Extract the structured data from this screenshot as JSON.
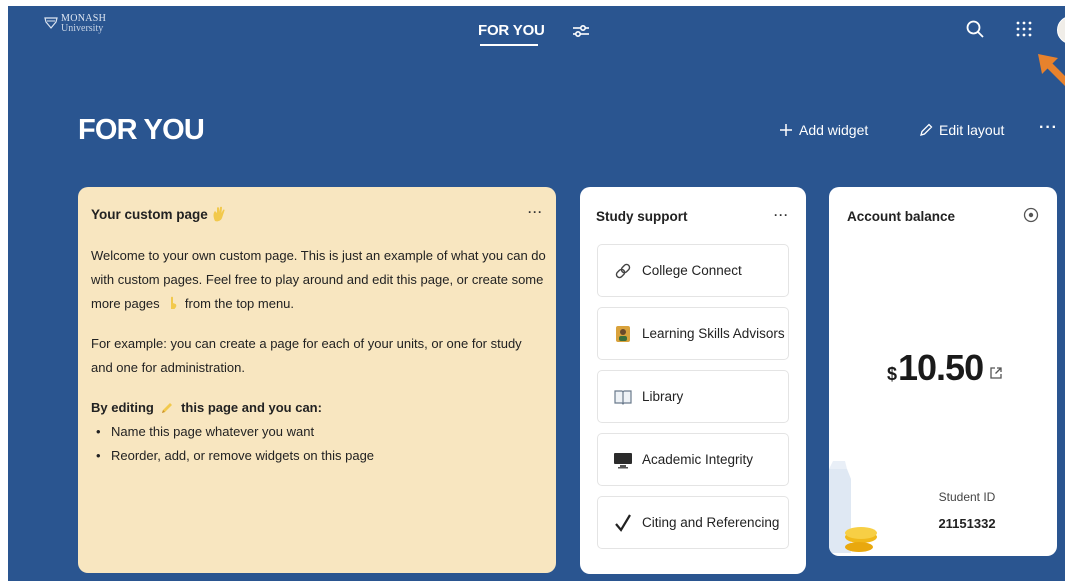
{
  "brand": {
    "line1": "MONASH",
    "line2": "University"
  },
  "nav": {
    "active_tab": "FOR YOU"
  },
  "header": {
    "title": "FOR YOU",
    "add_widget_label": "Add widget",
    "edit_layout_label": "Edit layout",
    "more_label": "···"
  },
  "custom_page": {
    "title": "Your custom page",
    "title_icon": "waving-hand-icon",
    "more_label": "···",
    "intro_before_icon": "Welcome to your own custom page. This is just an example of what you can do with custom pages. Feel free to play around and edit this page, or create some more pages",
    "intro_after_icon": "from the top menu.",
    "example": "For example: you can create a page for each of your units, or one for study and one for administration.",
    "editing_before": "By editing",
    "editing_after": "this page and you can:",
    "bullets": [
      "Name this page whatever you want",
      "Reorder, add, or remove widgets on this page"
    ]
  },
  "study_support": {
    "title": "Study support",
    "more_label": "···",
    "items": [
      {
        "label": "College Connect",
        "icon": "link-icon"
      },
      {
        "label": "Learning Skills Advisors",
        "icon": "advisor-icon"
      },
      {
        "label": "Library",
        "icon": "book-icon"
      },
      {
        "label": "Academic Integrity",
        "icon": "monitor-icon"
      },
      {
        "label": "Citing and Referencing",
        "icon": "checkmark-icon"
      }
    ]
  },
  "account_balance": {
    "title": "Account balance",
    "currency": "$",
    "amount": "10.50",
    "student_id_label": "Student ID",
    "student_id": "21151332"
  },
  "colors": {
    "background": "#2a5590",
    "custom_card": "#f8e6c0",
    "annotation_arrow": "#e8822c"
  }
}
